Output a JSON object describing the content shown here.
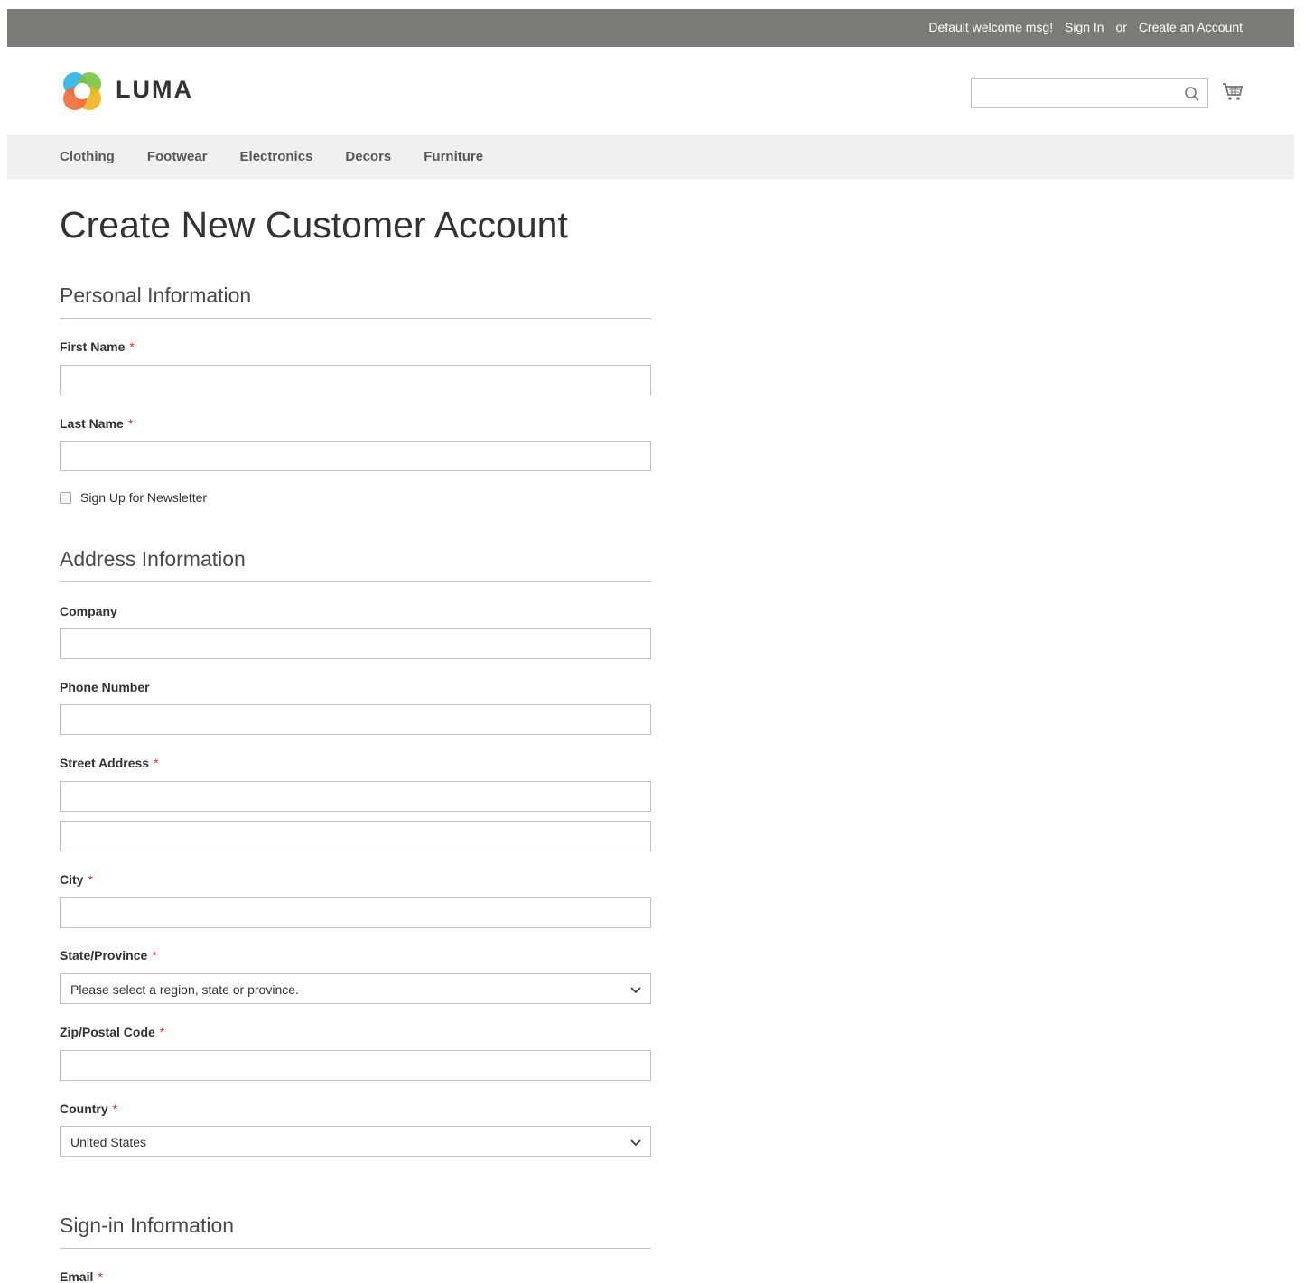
{
  "topbar": {
    "welcome": "Default welcome msg!",
    "sign_in": "Sign In",
    "or": "or",
    "create_account": "Create an Account"
  },
  "header": {
    "logo_text": "LUMA",
    "search_placeholder": "",
    "search_icon": "search-icon",
    "cart_icon": "cart-icon"
  },
  "nav": {
    "items": [
      "Clothing",
      "Footwear",
      "Electronics",
      "Decors",
      "Furniture"
    ]
  },
  "page": {
    "title": "Create New Customer Account"
  },
  "personal": {
    "legend": "Personal Information",
    "first_name_label": "First Name",
    "last_name_label": "Last Name",
    "newsletter_label": "Sign Up for Newsletter"
  },
  "address": {
    "legend": "Address Information",
    "company_label": "Company",
    "phone_label": "Phone Number",
    "street_label": "Street Address",
    "city_label": "City",
    "state_label": "State/Province",
    "state_value": "Please select a region, state or province.",
    "zip_label": "Zip/Postal Code",
    "country_label": "Country",
    "country_value": "United States"
  },
  "signin": {
    "legend": "Sign-in Information",
    "email_label": "Email"
  },
  "required_marker": "*",
  "colors": {
    "topbar_bg": "#7b7b78",
    "nav_bg": "#f0f0f0",
    "required": "#e02b27"
  }
}
